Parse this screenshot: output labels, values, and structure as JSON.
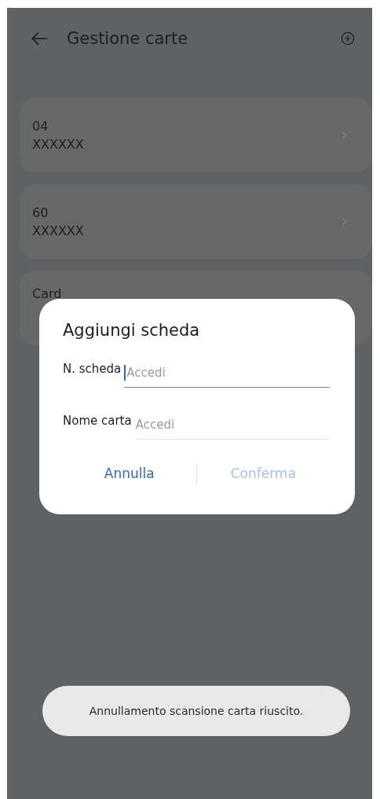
{
  "header": {
    "title": "Gestione carte"
  },
  "cards": [
    {
      "number": "04",
      "name": "XXXXXX"
    },
    {
      "number": "60",
      "name": "XXXXXX"
    },
    {
      "number": "Card"
    }
  ],
  "dialog": {
    "title": "Aggiungi scheda",
    "fields": [
      {
        "label": "N. scheda",
        "placeholder": "Accedi",
        "focused": true
      },
      {
        "label": "Nome carta",
        "placeholder": "Accedi",
        "focused": false
      }
    ],
    "buttons": [
      {
        "label": "Annulla",
        "disabled": false
      },
      {
        "label": "Conferma",
        "disabled": true
      }
    ]
  },
  "toast": "Annullamento scansione carta riuscito."
}
